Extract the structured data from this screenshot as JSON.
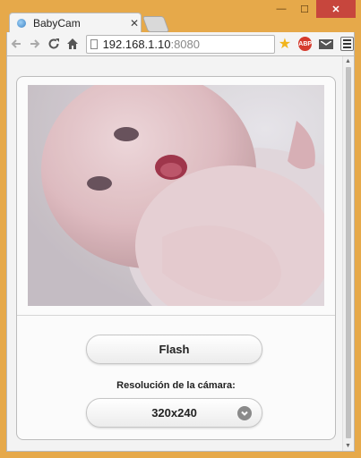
{
  "browser": {
    "tab_title": "BabyCam",
    "tab_close": "✕",
    "url_host": "192.168.1.10",
    "url_port": ":8080",
    "window_controls": {
      "minimize": "—",
      "maximize": "☐",
      "close": "✕"
    },
    "extensions": {
      "abp": "ABP"
    }
  },
  "page": {
    "camera_feed_alt": "",
    "flash_label": "Flash",
    "resolution_label": "Resolución de la cámara:",
    "resolution_value": "320x240"
  },
  "colors": {
    "window_frame": "#e6a94a",
    "close_button": "#c7463d",
    "star": "#f1b41c",
    "abp": "#d53b2d"
  }
}
